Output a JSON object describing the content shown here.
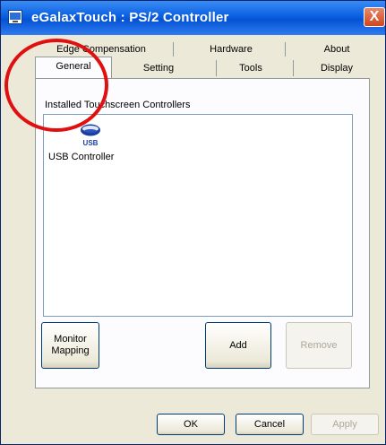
{
  "window": {
    "title": "eGalaxTouch : PS/2 Controller",
    "close_label": "X"
  },
  "tabs": {
    "row1": [
      {
        "label": "Edge Compensation"
      },
      {
        "label": "Hardware"
      },
      {
        "label": "About"
      }
    ],
    "row2": [
      {
        "label": "General",
        "selected": true
      },
      {
        "label": "Setting"
      },
      {
        "label": "Tools"
      },
      {
        "label": "Display"
      }
    ]
  },
  "general": {
    "group_label": "Installed Touchscreen Controllers",
    "controllers": [
      {
        "icon": "usb-icon",
        "icon_text": "USB",
        "label": "USB Controller"
      }
    ],
    "buttons": {
      "monitor_mapping": "Monitor Mapping",
      "add": "Add",
      "remove": "Remove"
    }
  },
  "dialog_buttons": {
    "ok": "OK",
    "cancel": "Cancel",
    "apply": "Apply"
  },
  "colors": {
    "title_bar": "#0553d4",
    "highlight_circle": "#e01010"
  }
}
